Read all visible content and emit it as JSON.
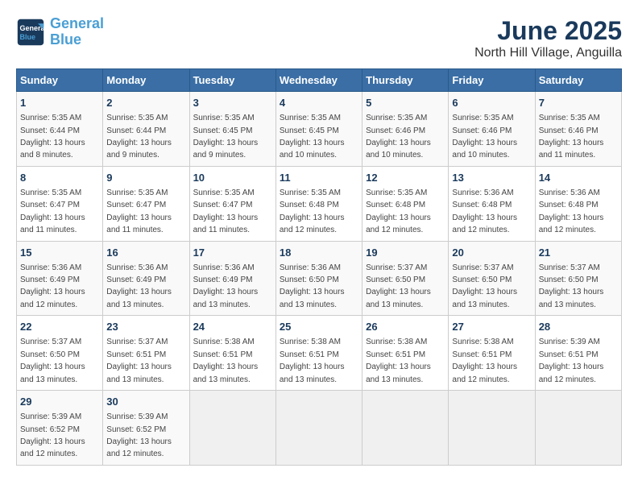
{
  "logo": {
    "line1": "General",
    "line2": "Blue"
  },
  "title": "June 2025",
  "subtitle": "North Hill Village, Anguilla",
  "weekdays": [
    "Sunday",
    "Monday",
    "Tuesday",
    "Wednesday",
    "Thursday",
    "Friday",
    "Saturday"
  ],
  "weeks": [
    [
      {
        "day": "1",
        "sunrise": "5:35 AM",
        "sunset": "6:44 PM",
        "daylight": "13 hours and 8 minutes."
      },
      {
        "day": "2",
        "sunrise": "5:35 AM",
        "sunset": "6:44 PM",
        "daylight": "13 hours and 9 minutes."
      },
      {
        "day": "3",
        "sunrise": "5:35 AM",
        "sunset": "6:45 PM",
        "daylight": "13 hours and 9 minutes."
      },
      {
        "day": "4",
        "sunrise": "5:35 AM",
        "sunset": "6:45 PM",
        "daylight": "13 hours and 10 minutes."
      },
      {
        "day": "5",
        "sunrise": "5:35 AM",
        "sunset": "6:46 PM",
        "daylight": "13 hours and 10 minutes."
      },
      {
        "day": "6",
        "sunrise": "5:35 AM",
        "sunset": "6:46 PM",
        "daylight": "13 hours and 10 minutes."
      },
      {
        "day": "7",
        "sunrise": "5:35 AM",
        "sunset": "6:46 PM",
        "daylight": "13 hours and 11 minutes."
      }
    ],
    [
      {
        "day": "8",
        "sunrise": "5:35 AM",
        "sunset": "6:47 PM",
        "daylight": "13 hours and 11 minutes."
      },
      {
        "day": "9",
        "sunrise": "5:35 AM",
        "sunset": "6:47 PM",
        "daylight": "13 hours and 11 minutes."
      },
      {
        "day": "10",
        "sunrise": "5:35 AM",
        "sunset": "6:47 PM",
        "daylight": "13 hours and 11 minutes."
      },
      {
        "day": "11",
        "sunrise": "5:35 AM",
        "sunset": "6:48 PM",
        "daylight": "13 hours and 12 minutes."
      },
      {
        "day": "12",
        "sunrise": "5:35 AM",
        "sunset": "6:48 PM",
        "daylight": "13 hours and 12 minutes."
      },
      {
        "day": "13",
        "sunrise": "5:36 AM",
        "sunset": "6:48 PM",
        "daylight": "13 hours and 12 minutes."
      },
      {
        "day": "14",
        "sunrise": "5:36 AM",
        "sunset": "6:48 PM",
        "daylight": "13 hours and 12 minutes."
      }
    ],
    [
      {
        "day": "15",
        "sunrise": "5:36 AM",
        "sunset": "6:49 PM",
        "daylight": "13 hours and 12 minutes."
      },
      {
        "day": "16",
        "sunrise": "5:36 AM",
        "sunset": "6:49 PM",
        "daylight": "13 hours and 13 minutes."
      },
      {
        "day": "17",
        "sunrise": "5:36 AM",
        "sunset": "6:49 PM",
        "daylight": "13 hours and 13 minutes."
      },
      {
        "day": "18",
        "sunrise": "5:36 AM",
        "sunset": "6:50 PM",
        "daylight": "13 hours and 13 minutes."
      },
      {
        "day": "19",
        "sunrise": "5:37 AM",
        "sunset": "6:50 PM",
        "daylight": "13 hours and 13 minutes."
      },
      {
        "day": "20",
        "sunrise": "5:37 AM",
        "sunset": "6:50 PM",
        "daylight": "13 hours and 13 minutes."
      },
      {
        "day": "21",
        "sunrise": "5:37 AM",
        "sunset": "6:50 PM",
        "daylight": "13 hours and 13 minutes."
      }
    ],
    [
      {
        "day": "22",
        "sunrise": "5:37 AM",
        "sunset": "6:50 PM",
        "daylight": "13 hours and 13 minutes."
      },
      {
        "day": "23",
        "sunrise": "5:37 AM",
        "sunset": "6:51 PM",
        "daylight": "13 hours and 13 minutes."
      },
      {
        "day": "24",
        "sunrise": "5:38 AM",
        "sunset": "6:51 PM",
        "daylight": "13 hours and 13 minutes."
      },
      {
        "day": "25",
        "sunrise": "5:38 AM",
        "sunset": "6:51 PM",
        "daylight": "13 hours and 13 minutes."
      },
      {
        "day": "26",
        "sunrise": "5:38 AM",
        "sunset": "6:51 PM",
        "daylight": "13 hours and 13 minutes."
      },
      {
        "day": "27",
        "sunrise": "5:38 AM",
        "sunset": "6:51 PM",
        "daylight": "13 hours and 12 minutes."
      },
      {
        "day": "28",
        "sunrise": "5:39 AM",
        "sunset": "6:51 PM",
        "daylight": "13 hours and 12 minutes."
      }
    ],
    [
      {
        "day": "29",
        "sunrise": "5:39 AM",
        "sunset": "6:52 PM",
        "daylight": "13 hours and 12 minutes."
      },
      {
        "day": "30",
        "sunrise": "5:39 AM",
        "sunset": "6:52 PM",
        "daylight": "13 hours and 12 minutes."
      },
      null,
      null,
      null,
      null,
      null
    ]
  ],
  "labels": {
    "sunrise_prefix": "Sunrise: ",
    "sunset_prefix": "Sunset: ",
    "daylight_prefix": "Daylight: "
  }
}
